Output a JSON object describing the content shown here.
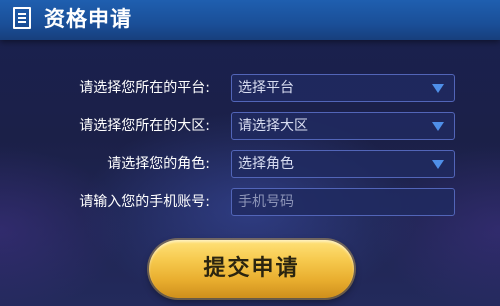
{
  "header": {
    "title": "资格申请",
    "icon": "document-icon"
  },
  "form": {
    "platform": {
      "label": "请选择您所在的平台:",
      "value": "选择平台"
    },
    "region": {
      "label": "请选择您所在的大区:",
      "value": "请选择大区"
    },
    "role": {
      "label": "请选择您的角色:",
      "value": "选择角色"
    },
    "phone": {
      "label": "请输入您的手机账号:",
      "placeholder": "手机号码"
    }
  },
  "submit_label": "提交申请",
  "colors": {
    "header": "#1a4f98",
    "background": "#1b2048",
    "button": "#f6c94d",
    "arrow": "#4f8fe8"
  }
}
